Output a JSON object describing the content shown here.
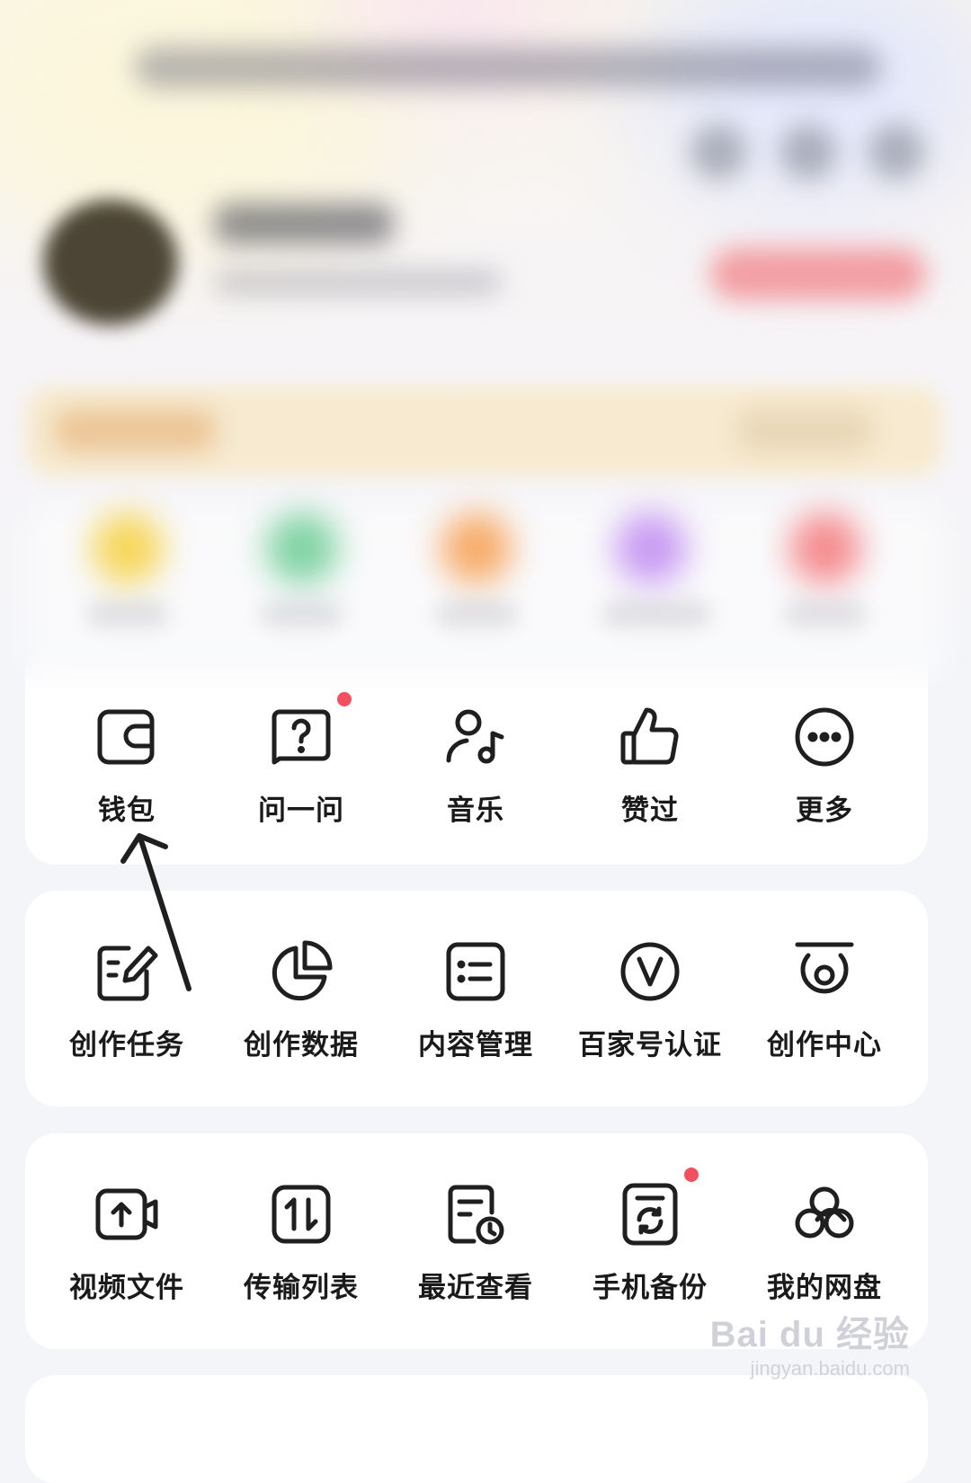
{
  "quick_actions": [
    {
      "label": "钱包",
      "icon": "wallet-icon",
      "badge": false
    },
    {
      "label": "问一问",
      "icon": "question-bubble-icon",
      "badge": true
    },
    {
      "label": "音乐",
      "icon": "music-person-icon",
      "badge": false
    },
    {
      "label": "赞过",
      "icon": "thumbs-up-icon",
      "badge": false
    },
    {
      "label": "更多",
      "icon": "more-dots-icon",
      "badge": false
    }
  ],
  "creator_tools": [
    {
      "label": "创作任务",
      "icon": "task-edit-icon"
    },
    {
      "label": "创作数据",
      "icon": "pie-chart-icon"
    },
    {
      "label": "内容管理",
      "icon": "list-manage-icon"
    },
    {
      "label": "百家号认证",
      "icon": "verified-v-icon"
    },
    {
      "label": "创作中心",
      "icon": "creator-center-icon"
    }
  ],
  "disk_tools": [
    {
      "label": "视频文件",
      "icon": "video-upload-icon",
      "badge": false
    },
    {
      "label": "传输列表",
      "icon": "transfer-icon",
      "badge": false
    },
    {
      "label": "最近查看",
      "icon": "recent-doc-icon",
      "badge": false
    },
    {
      "label": "手机备份",
      "icon": "phone-backup-icon",
      "badge": true
    },
    {
      "label": "我的网盘",
      "icon": "netdisk-cloud-icon",
      "badge": false
    }
  ],
  "watermark": {
    "brand": "Bai  du 经验",
    "url": "jingyan.baidu.com"
  },
  "colors": {
    "badge": "#f2505e",
    "icon_stroke": "#1f1f1f",
    "annotation_arrow": "#1f1f1f"
  }
}
